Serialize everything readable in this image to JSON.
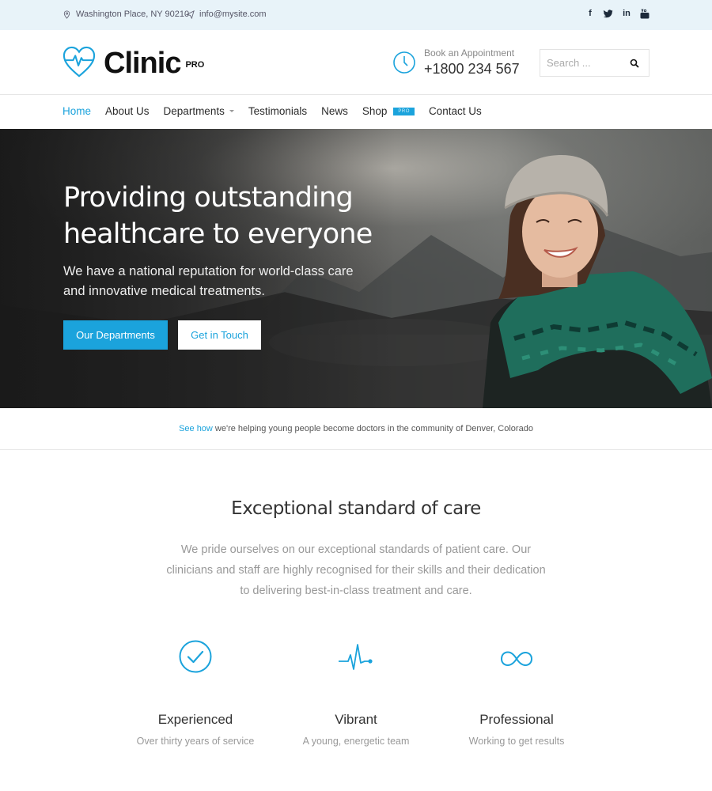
{
  "colors": {
    "accent": "#1ba3dc",
    "topbar_bg": "#e8f3f9"
  },
  "topbar": {
    "address": "Washington Place, NY 90210",
    "email": "info@mysite.com",
    "social": [
      "f",
      "t",
      "in",
      "yt"
    ]
  },
  "header": {
    "logo_text": "Clinic",
    "logo_badge": "PRO",
    "appointment_label": "Book an Appointment",
    "appointment_phone": "+1800 234 567",
    "search_placeholder": "Search ..."
  },
  "nav": {
    "items": [
      {
        "label": "Home"
      },
      {
        "label": "About Us"
      },
      {
        "label": "Departments"
      },
      {
        "label": "Testimonials"
      },
      {
        "label": "News"
      },
      {
        "label": "Shop",
        "badge": "PRO"
      },
      {
        "label": "Contact Us"
      }
    ]
  },
  "hero": {
    "title_line1": "Providing outstanding",
    "title_line2": "healthcare to everyone",
    "subtitle": "We have a national reputation for world-class care and innovative medical treatments.",
    "primary_button": "Our Departments",
    "secondary_button": "Get in Touch"
  },
  "notice": {
    "link_text": "See how",
    "text": " we're helping young people become doctors in the community of Denver, Colorado"
  },
  "section": {
    "title": "Exceptional standard of care",
    "text": "We pride ourselves on our exceptional standards of patient care. Our clinicians and staff are highly recognised for their skills and their dedication to delivering best-in-class treatment and care."
  },
  "features": [
    {
      "icon": "check-circle-icon",
      "title": "Experienced",
      "subtitle": "Over thirty years of service"
    },
    {
      "icon": "pulse-icon",
      "title": "Vibrant",
      "subtitle": "A young, energetic team"
    },
    {
      "icon": "infinity-icon",
      "title": "Professional",
      "subtitle": "Working to get results"
    }
  ]
}
